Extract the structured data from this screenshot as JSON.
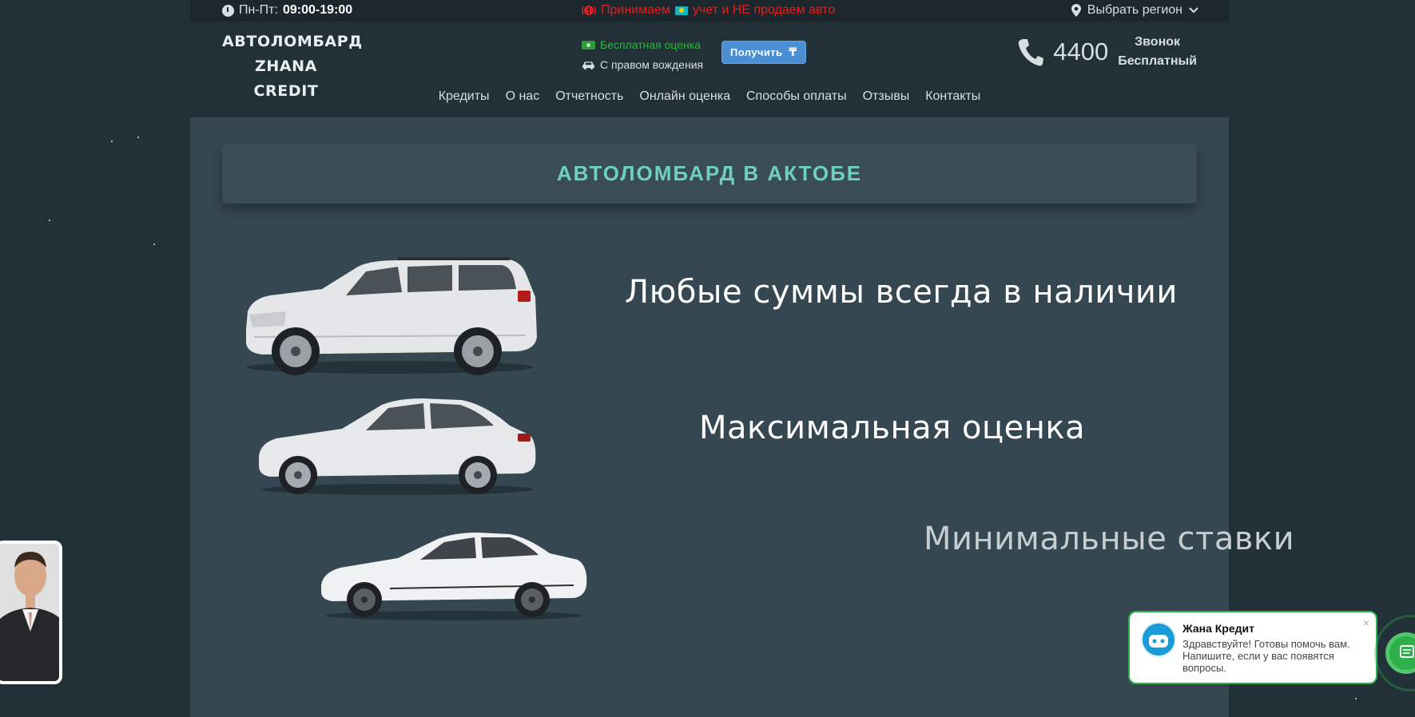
{
  "topbar": {
    "hours_label": "Пн-Пт:",
    "hours_value": "09:00-19:00",
    "promo_part1": "Принимаем",
    "promo_part2": "учет и НЕ продаем авто",
    "region_label": "Выбрать регион"
  },
  "header": {
    "logo_line1": "АВТОЛОМБАРД",
    "logo_line2": "ZHANA CREDIT",
    "feature_free": "Бесплатная оценка",
    "feature_drive": "С правом вождения",
    "get_button": "Получить",
    "phone_number": "4400",
    "phone_sub1": "Звонок",
    "phone_sub2": "Бесплатный"
  },
  "nav": {
    "items": [
      "Кредиты",
      "О нас",
      "Отчетность",
      "Онлайн оценка",
      "Способы оплаты",
      "Отзывы",
      "Контакты"
    ]
  },
  "main": {
    "title": "АВТОЛОМБАРД В АКТОБЕ",
    "slogan1": "Любые суммы всегда в наличии",
    "slogan2": "Максимальная оценка",
    "slogan3": "Минимальные ставки"
  },
  "chat": {
    "name": "Жана Кредит",
    "message": "Здравствуйте! Готовы помочь вам. Напишите, если у вас появятся вопросы.",
    "close": "×"
  },
  "colors": {
    "accent_teal": "#6ed0c0",
    "promo_red": "#e02020",
    "button_blue": "#4a8fd4",
    "chat_green": "#2db04a"
  }
}
